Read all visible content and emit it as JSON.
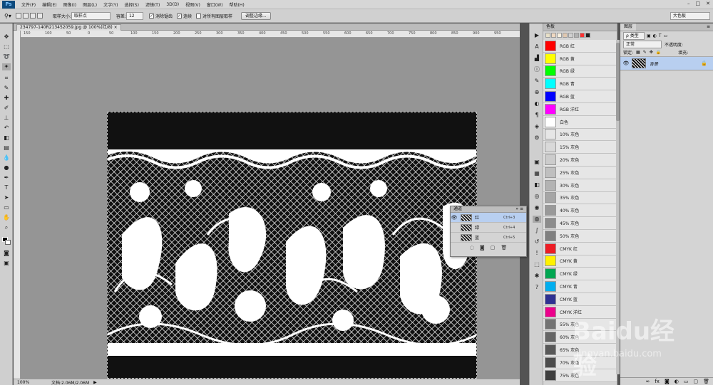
{
  "app": {
    "logo": "Ps",
    "menus": [
      "文件(F)",
      "编辑(E)",
      "图像(I)",
      "图层(L)",
      "文字(Y)",
      "选择(S)",
      "滤镜(T)",
      "3D(D)",
      "视图(V)",
      "窗口(W)",
      "帮助(H)"
    ]
  },
  "options": {
    "sample_size_label": "取样大小:",
    "sample_size_value": "取样点",
    "tolerance_label": "容差:",
    "tolerance_value": "12",
    "antialias_label": "消除锯齿",
    "contiguous_label": "连续",
    "all_layers_label": "对所有图层取样",
    "refine_edge_button": "调整边缘...",
    "workspace": "大色板"
  },
  "document": {
    "tab_title": "234797-140R213452059.jpg @ 100%(红/8)",
    "ruler_ticks": [
      "150",
      "100",
      "50",
      "0",
      "50",
      "100",
      "150",
      "200",
      "250",
      "300",
      "350",
      "400",
      "450",
      "500",
      "550",
      "600",
      "650",
      "700",
      "750",
      "800",
      "850",
      "900",
      "950"
    ]
  },
  "status": {
    "zoom": "100%",
    "doc_size": "文档:2.06M/2.06M"
  },
  "channels_panel": {
    "title": "通道",
    "rows": [
      {
        "name": "红",
        "shortcut": "Ctrl+3",
        "active": true
      },
      {
        "name": "绿",
        "shortcut": "Ctrl+4",
        "active": false
      },
      {
        "name": "蓝",
        "shortcut": "Ctrl+5",
        "active": false
      }
    ]
  },
  "swatches_panel": {
    "title": "色板",
    "items": [
      {
        "name": "RGB 红",
        "color": "#ff0000"
      },
      {
        "name": "RGB 黄",
        "color": "#ffff00"
      },
      {
        "name": "RGB 绿",
        "color": "#00ff00"
      },
      {
        "name": "RGB 青",
        "color": "#00ffff"
      },
      {
        "name": "RGB 蓝",
        "color": "#0000ff"
      },
      {
        "name": "RGB 洋红",
        "color": "#ff00ff"
      },
      {
        "name": "白色",
        "color": "#ffffff"
      },
      {
        "name": "10% 灰色",
        "color": "#e6e6e6"
      },
      {
        "name": "15% 灰色",
        "color": "#d9d9d9"
      },
      {
        "name": "20% 灰色",
        "color": "#cccccc"
      },
      {
        "name": "25% 灰色",
        "color": "#bfbfbf"
      },
      {
        "name": "30% 灰色",
        "color": "#b3b3b3"
      },
      {
        "name": "35% 灰色",
        "color": "#a6a6a6"
      },
      {
        "name": "40% 灰色",
        "color": "#999999"
      },
      {
        "name": "45% 灰色",
        "color": "#8c8c8c"
      },
      {
        "name": "50% 灰色",
        "color": "#808080"
      },
      {
        "name": "CMYK 红",
        "color": "#ed1c24"
      },
      {
        "name": "CMYK 黄",
        "color": "#fff200"
      },
      {
        "name": "CMYK 绿",
        "color": "#00a651"
      },
      {
        "name": "CMYK 青",
        "color": "#00aeef"
      },
      {
        "name": "CMYK 蓝",
        "color": "#2e3192"
      },
      {
        "name": "CMYK 洋红",
        "color": "#ec008c"
      },
      {
        "name": "55% 灰色",
        "color": "#737373"
      },
      {
        "name": "60% 灰色",
        "color": "#666666"
      },
      {
        "name": "65% 灰色",
        "color": "#595959"
      },
      {
        "name": "70% 灰色",
        "color": "#4d4d4d"
      },
      {
        "name": "75% 灰色",
        "color": "#404040"
      }
    ]
  },
  "layers_panel": {
    "tab": "图层",
    "kind_label": "ρ 类型",
    "blend_mode": "正常",
    "opacity_label": "不透明度:",
    "lock_label": "锁定:",
    "fill_label": "填充:",
    "layer_name": "背景"
  },
  "watermark": {
    "brand": "Baidu经验",
    "url": "jingyan.baidu.com"
  }
}
